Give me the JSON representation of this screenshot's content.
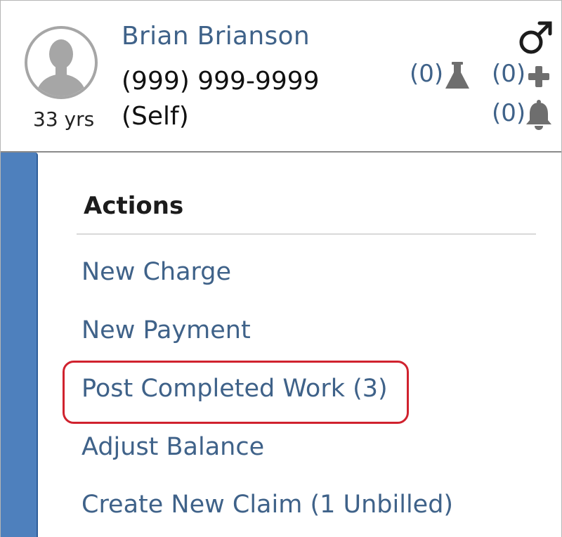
{
  "patient": {
    "name": "Brian Brianson",
    "phone": "(999) 999-9999",
    "relation": "(Self)",
    "age": "33 yrs",
    "gender_icon": "male-symbol-icon",
    "avatar_icon": "person-silhouette-icon"
  },
  "indicators": {
    "lab": {
      "count": "(0)",
      "icon": "flask-icon"
    },
    "medical": {
      "count": "(0)",
      "icon": "plus-icon"
    },
    "alerts": {
      "count": "(0)",
      "icon": "bell-icon"
    }
  },
  "actions": {
    "title": "Actions",
    "items": [
      {
        "label": "New Charge"
      },
      {
        "label": "New Payment"
      },
      {
        "label": "Post Completed Work (3)",
        "highlighted": true
      },
      {
        "label": "Adjust Balance"
      },
      {
        "label": "Create New Claim (1 Unbilled)"
      }
    ]
  },
  "colors": {
    "link": "#3f6289",
    "sidebar": "#4e80bd",
    "highlight": "#d0222e",
    "icon": "#6e6e6e"
  }
}
